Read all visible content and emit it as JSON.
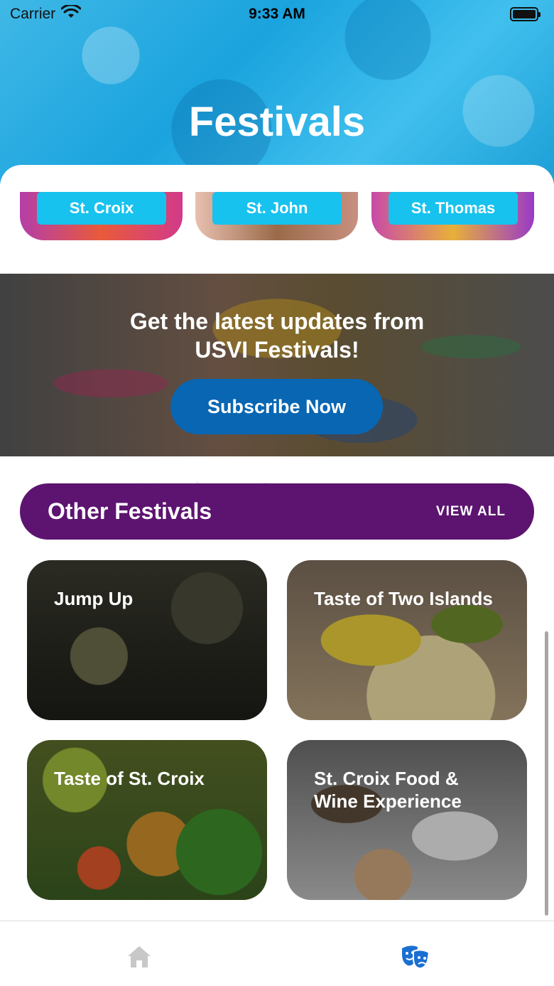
{
  "status_bar": {
    "carrier": "Carrier",
    "time": "9:33 AM"
  },
  "header": {
    "title": "Festivals"
  },
  "islands": [
    {
      "label": "St. Croix"
    },
    {
      "label": "St. John"
    },
    {
      "label": "St. Thomas"
    }
  ],
  "banner": {
    "text": "Get the latest updates from USVI Festivals!",
    "button_label": "Subscribe Now"
  },
  "watermark": "UpdateStar.com",
  "other_festivals": {
    "title": "Other Festivals",
    "view_all_label": "VIEW ALL",
    "cards": [
      {
        "title": "Jump Up"
      },
      {
        "title": "Taste of Two Islands"
      },
      {
        "title": "Taste of St. Croix"
      },
      {
        "title": "St. Croix Food & Wine Experience"
      }
    ]
  },
  "tabbar": {
    "items": [
      {
        "icon": "home-icon",
        "active": false
      },
      {
        "icon": "theater-masks-icon",
        "active": true
      }
    ],
    "active_color": "#1a6fd1",
    "inactive_color": "#c8c8c8"
  },
  "colors": {
    "island_label": "#17c2ee",
    "subscribe_button": "#0866b3",
    "section_header": "#5c1470"
  }
}
